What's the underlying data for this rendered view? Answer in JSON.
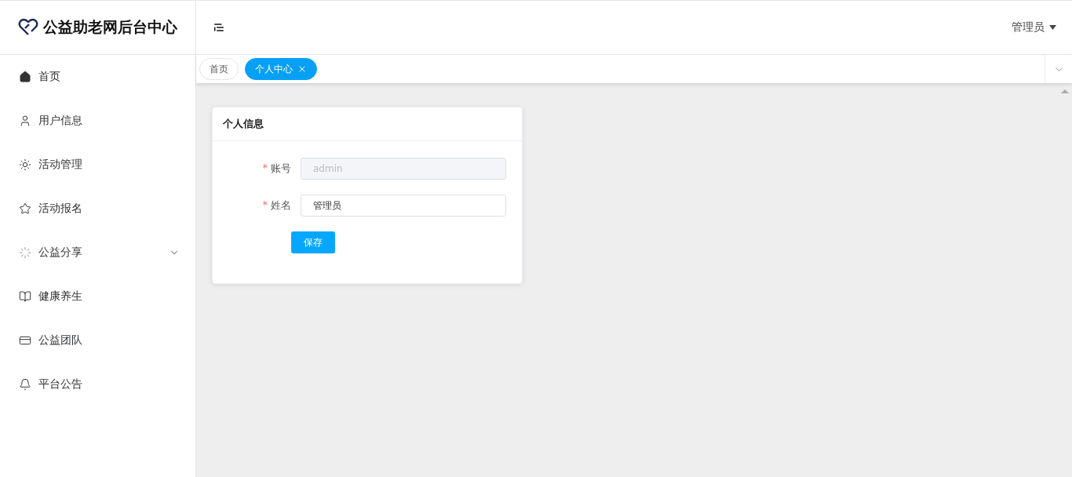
{
  "brand": {
    "title": "公益助老网后台中心"
  },
  "sidebar": {
    "items": [
      {
        "label": "首页",
        "expandable": false
      },
      {
        "label": "用户信息",
        "expandable": false
      },
      {
        "label": "活动管理",
        "expandable": false
      },
      {
        "label": "活动报名",
        "expandable": false
      },
      {
        "label": "公益分享",
        "expandable": true
      },
      {
        "label": "健康养生",
        "expandable": false
      },
      {
        "label": "公益团队",
        "expandable": false
      },
      {
        "label": "平台公告",
        "expandable": false
      }
    ]
  },
  "header": {
    "user": "管理员"
  },
  "tabs": [
    {
      "label": "首页",
      "selected": false,
      "closable": false
    },
    {
      "label": "个人中心",
      "selected": true,
      "closable": true
    }
  ],
  "card": {
    "title": "个人信息",
    "fields": [
      {
        "label": "账号",
        "required_mark": "*",
        "value": "admin",
        "disabled": true
      },
      {
        "label": "姓名",
        "required_mark": "*",
        "value": "管理员",
        "disabled": false
      }
    ],
    "button": "保存"
  }
}
